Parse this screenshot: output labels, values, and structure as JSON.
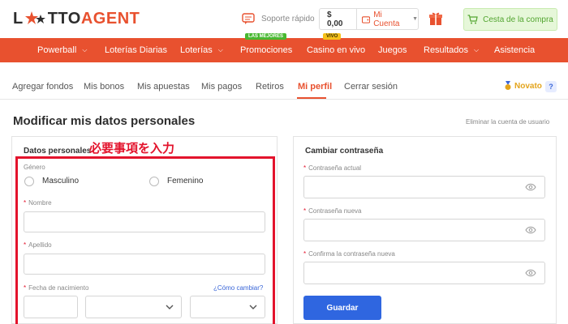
{
  "header": {
    "logo_l": "L",
    "logo_rest_dark": "TTO",
    "logo_rest_accent": "AGENT",
    "support_label": "Soporte rápido",
    "balance": "$ 0,00",
    "my_account_label": "Mi Cuenta",
    "cart_label": "Cesta de la compra"
  },
  "nav": {
    "items": [
      {
        "label": "Powerball",
        "has_chevron": true
      },
      {
        "label": "Loterías Diarias",
        "has_chevron": false
      },
      {
        "label": "Loterías",
        "has_chevron": true
      },
      {
        "label": "Promociones",
        "has_chevron": false,
        "badge": "LAS MEJORES"
      },
      {
        "label": "Casino en vivo",
        "has_chevron": false,
        "badge": "VIVO"
      },
      {
        "label": "Juegos",
        "has_chevron": false
      },
      {
        "label": "Resultados",
        "has_chevron": true
      },
      {
        "label": "Asistencia",
        "has_chevron": false
      }
    ]
  },
  "subnav": {
    "items": [
      {
        "label": "Agregar fondos"
      },
      {
        "label": "Mis bonos"
      },
      {
        "label": "Mis apuestas"
      },
      {
        "label": "Mis pagos"
      },
      {
        "label": "Retiros"
      },
      {
        "label": "Mi perfil",
        "active": true
      },
      {
        "label": "Cerrar sesión"
      }
    ],
    "level_label": "Novato",
    "help_label": "?"
  },
  "page": {
    "title": "Modificar mis datos personales",
    "delete_account_link": "Eliminar la cuenta de usuario"
  },
  "personal": {
    "heading": "Datos personales",
    "annotation": "必要事項を入力",
    "gender_label": "Género",
    "gender_options": [
      "Masculino",
      "Femenino"
    ],
    "name_label": "Nombre",
    "surname_label": "Apellido",
    "birthdate_label": "Fecha de nacimiento",
    "how_to_change_link": "¿Cómo cambiar?",
    "required_mark": "*"
  },
  "password": {
    "heading": "Cambiar contraseña",
    "current_label": "Contraseña actual",
    "new_label": "Contraseña nueva",
    "confirm_label": "Confirma la contraseña nueva",
    "save_button": "Guardar",
    "required_mark": "*"
  },
  "colors": {
    "brand_orange": "#e8512f",
    "annotation_red": "#e3132c",
    "primary_blue": "#2f66e0",
    "cart_green": "#53a531"
  }
}
